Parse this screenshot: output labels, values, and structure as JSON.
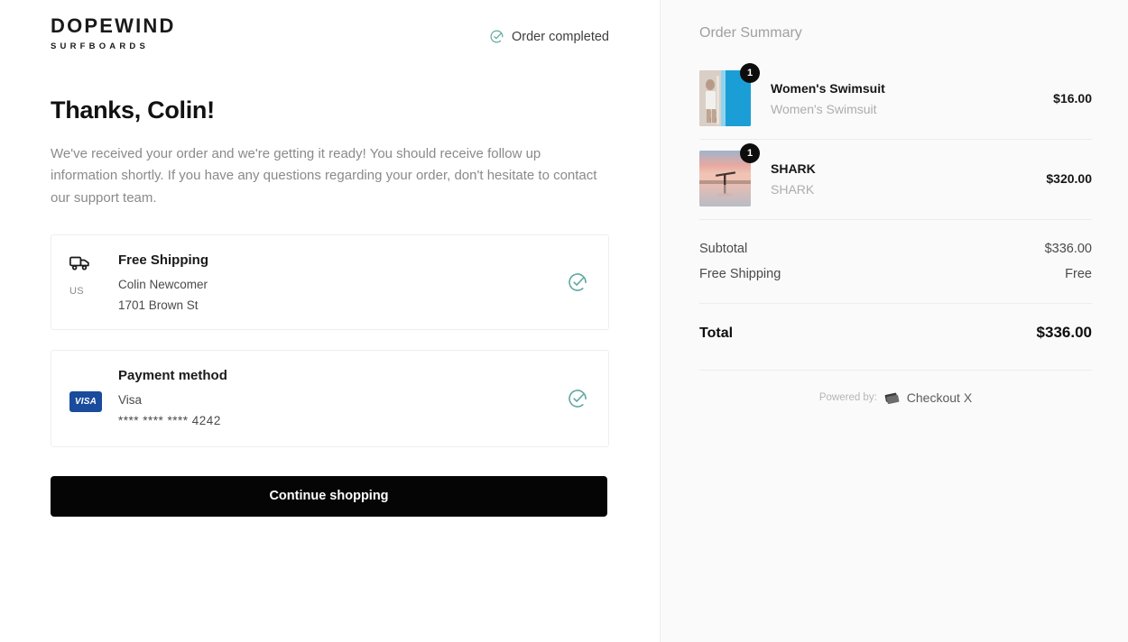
{
  "brand": {
    "name": "DOPEWIND",
    "tagline": "SURFBOARDS"
  },
  "header": {
    "status_label": "Order completed",
    "status_icon": "circle-check-icon",
    "status_color": "#5fa8a0"
  },
  "main": {
    "heading": "Thanks, Colin!",
    "intro": "We've received your order and we're getting it ready! You should receive follow up information shortly. If you have any questions regarding your order, don't hesitate to contact our support team.",
    "shipping_card": {
      "icon": "truck-icon",
      "country_code": "US",
      "title": "Free Shipping",
      "recipient": "Colin Newcomer",
      "address": "1701 Brown St",
      "confirmed_icon": "circle-check-icon"
    },
    "payment_card": {
      "badge_label": "VISA",
      "badge_color": "#1a4b9c",
      "title": "Payment method",
      "brand": "Visa",
      "masked_number": "**** **** **** 4242",
      "confirmed_icon": "circle-check-icon"
    },
    "continue_button": "Continue shopping"
  },
  "summary": {
    "title": "Order Summary",
    "items": [
      {
        "name": "Women's Swimsuit",
        "variant": "Women's Swimsuit",
        "quantity": "1",
        "price": "$16.00",
        "thumbnail": "woman-in-white-swimsuit-against-blue-wall"
      },
      {
        "name": "SHARK",
        "variant": "SHARK",
        "quantity": "1",
        "price": "$320.00",
        "thumbnail": "surfer-silhouette-at-sunset-beach"
      }
    ],
    "totals": [
      {
        "label": "Subtotal",
        "value": "$336.00"
      },
      {
        "label": "Free Shipping",
        "value": "Free"
      }
    ],
    "grand_total": {
      "label": "Total",
      "value": "$336.00"
    },
    "powered_by": {
      "label": "Powered by:",
      "icon": "checkout-card-icon",
      "brand": "Checkout X"
    }
  }
}
